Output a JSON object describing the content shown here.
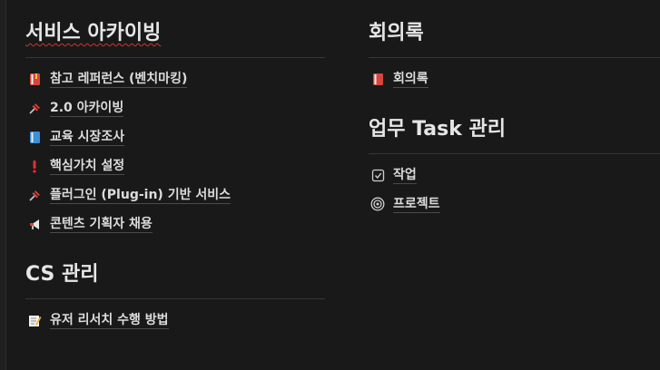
{
  "sections": {
    "archiving": {
      "title": "서비스 아카이빙",
      "items": [
        {
          "label": "참고 레퍼런스 (벤치마킹)",
          "icon": "red-book-icon"
        },
        {
          "label": "2.0 아카이빙",
          "icon": "pushpin-icon"
        },
        {
          "label": "교육 시장조사",
          "icon": "blue-book-icon"
        },
        {
          "label": "핵심가치 설정",
          "icon": "exclamation-icon"
        },
        {
          "label": "플러그인 (Plug-in) 기반 서비스",
          "icon": "pushpin-icon"
        },
        {
          "label": "콘텐츠 기획자 채용",
          "icon": "megaphone-icon"
        }
      ]
    },
    "cs": {
      "title": "CS 관리",
      "items": [
        {
          "label": "유저 리서치 수행 방법",
          "icon": "memo-icon"
        }
      ]
    },
    "minutes": {
      "title": "회의록",
      "items": [
        {
          "label": "회의록",
          "icon": "red-book-icon"
        }
      ]
    },
    "tasks": {
      "title": "업무 Task 관리",
      "items": [
        {
          "label": "작업",
          "icon": "checkbox-icon"
        },
        {
          "label": "프로젝트",
          "icon": "target-icon"
        }
      ]
    }
  },
  "colors": {
    "background": "#191919",
    "text": "#dcdcdc",
    "divider": "#373737",
    "spellcheck_underline": "#d0342c"
  }
}
